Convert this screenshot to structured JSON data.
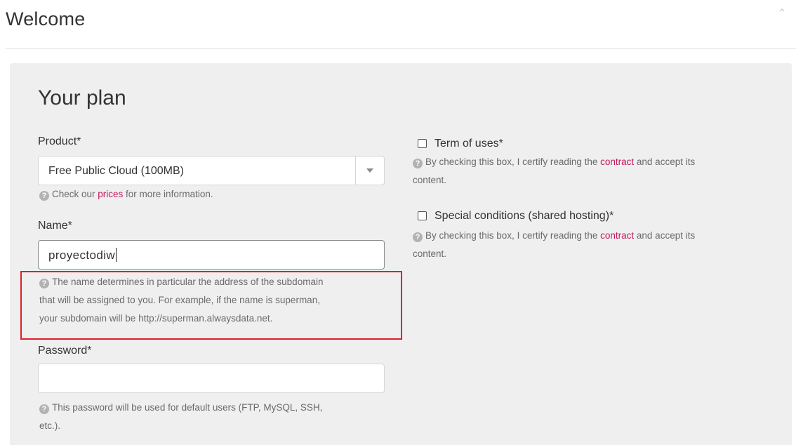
{
  "header": {
    "title": "Welcome"
  },
  "section": {
    "title": "Your plan"
  },
  "product": {
    "label": "Product*",
    "selected": "Free Public Cloud (100MB)",
    "help_prefix": "Check our ",
    "help_link": "prices",
    "help_suffix": " for more information."
  },
  "name": {
    "label": "Name*",
    "value": "proyectodiw",
    "help_line1": "The name determines in particular the address of the subdomain",
    "help_line2": "that will be assigned to you. For example, if the name is superman,",
    "help_line3": "your subdomain will be http://superman.alwaysdata.net."
  },
  "password": {
    "label": "Password*",
    "value": "",
    "help_line1": "This password will be used for default users (FTP, MySQL, SSH,",
    "help_line2": "etc.)."
  },
  "terms": {
    "label": "Term of uses*",
    "checked": false,
    "help_prefix": "By checking this box, I certify reading the ",
    "help_link": "contract",
    "help_suffix": " and accept its",
    "help_line2": "content."
  },
  "special": {
    "label": "Special conditions (shared hosting)*",
    "checked": false,
    "help_prefix": "By checking this box, I certify reading the ",
    "help_link": "contract",
    "help_suffix": " and accept its",
    "help_line2": "content."
  },
  "icons": {
    "help": "?",
    "collapse": "chevron-up-icon",
    "dropdown": "caret-down-icon"
  },
  "colors": {
    "link": "#c2185b",
    "highlight": "#e01f2c",
    "panel": "#efefef"
  }
}
